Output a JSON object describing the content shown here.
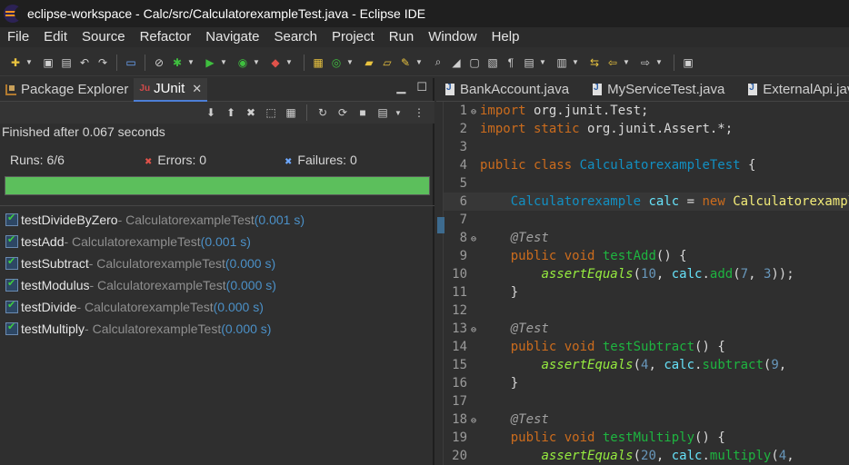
{
  "window": {
    "title": "eclipse-workspace - Calc/src/CalculatorexampleTest.java - Eclipse IDE"
  },
  "menu": [
    "File",
    "Edit",
    "Source",
    "Refactor",
    "Navigate",
    "Search",
    "Project",
    "Run",
    "Window",
    "Help"
  ],
  "colors": {
    "accent": "#4d7fd6",
    "progress_ok": "#5cbf5c",
    "time": "#4b90c7"
  },
  "left_tabs": {
    "package_explorer": "Package Explorer",
    "junit": "JUnit"
  },
  "junit": {
    "finished": "Finished after 0.067 seconds",
    "runs_label": "Runs:",
    "runs_value": "6/6",
    "errors_label": "Errors:",
    "errors_value": "0",
    "failures_label": "Failures:",
    "failures_value": "0",
    "progress_fraction": 1.0,
    "tests": [
      {
        "name": "testDivideByZero",
        "cls": " - CalculatorexampleTest ",
        "time": "(0.001 s)"
      },
      {
        "name": "testAdd",
        "cls": " - CalculatorexampleTest ",
        "time": "(0.001 s)"
      },
      {
        "name": "testSubtract",
        "cls": " - CalculatorexampleTest ",
        "time": "(0.000 s)"
      },
      {
        "name": "testModulus",
        "cls": " - CalculatorexampleTest ",
        "time": "(0.000 s)"
      },
      {
        "name": "testDivide",
        "cls": " - CalculatorexampleTest ",
        "time": "(0.000 s)"
      },
      {
        "name": "testMultiply",
        "cls": " - CalculatorexampleTest ",
        "time": "(0.000 s)"
      }
    ]
  },
  "editor_tabs": [
    "BankAccount.java",
    "MyServiceTest.java",
    "ExternalApi.java"
  ],
  "code": {
    "lines": [
      {
        "n": "1",
        "fold": "⊖",
        "parts": [
          [
            "kw",
            "import"
          ],
          [
            "txt",
            " org.junit.Test;"
          ]
        ]
      },
      {
        "n": "2",
        "fold": "",
        "parts": [
          [
            "kw",
            "import static"
          ],
          [
            "txt",
            " org.junit.Assert.*;"
          ]
        ]
      },
      {
        "n": "3",
        "fold": "",
        "parts": []
      },
      {
        "n": "4",
        "fold": "",
        "parts": [
          [
            "kw",
            "public class"
          ],
          [
            "txt",
            " "
          ],
          [
            "ty",
            "CalculatorexampleTest"
          ],
          [
            "txt",
            " {"
          ]
        ]
      },
      {
        "n": "5",
        "fold": "",
        "parts": []
      },
      {
        "n": "6",
        "fold": "",
        "current": true,
        "parts": [
          [
            "txt",
            "    "
          ],
          [
            "ty",
            "Calculatorexample"
          ],
          [
            "txt",
            " "
          ],
          [
            "fld",
            "calc"
          ],
          [
            "txt",
            " = "
          ],
          [
            "kw",
            "new"
          ],
          [
            "txt",
            " "
          ],
          [
            "vr",
            "Calculatorexample"
          ],
          [
            "txt",
            "();"
          ]
        ]
      },
      {
        "n": "7",
        "fold": "",
        "parts": []
      },
      {
        "n": "8",
        "fold": "⊖",
        "parts": [
          [
            "txt",
            "    "
          ],
          [
            "ann",
            "@Test"
          ]
        ]
      },
      {
        "n": "9",
        "fold": "",
        "parts": [
          [
            "txt",
            "    "
          ],
          [
            "kw",
            "public void"
          ],
          [
            "txt",
            " "
          ],
          [
            "mth",
            "testAdd"
          ],
          [
            "txt",
            "() {"
          ]
        ]
      },
      {
        "n": "10",
        "fold": "",
        "parts": [
          [
            "txt",
            "        "
          ],
          [
            "sm",
            "assertEquals"
          ],
          [
            "txt",
            "("
          ],
          [
            "num",
            "10"
          ],
          [
            "txt",
            ", "
          ],
          [
            "fld",
            "calc"
          ],
          [
            "txt",
            "."
          ],
          [
            "mth",
            "add"
          ],
          [
            "txt",
            "("
          ],
          [
            "num",
            "7"
          ],
          [
            "txt",
            ", "
          ],
          [
            "num",
            "3"
          ],
          [
            "txt",
            "));"
          ]
        ]
      },
      {
        "n": "11",
        "fold": "",
        "parts": [
          [
            "txt",
            "    }"
          ]
        ]
      },
      {
        "n": "12",
        "fold": "",
        "parts": []
      },
      {
        "n": "13",
        "fold": "⊖",
        "parts": [
          [
            "txt",
            "    "
          ],
          [
            "ann",
            "@Test"
          ]
        ]
      },
      {
        "n": "14",
        "fold": "",
        "parts": [
          [
            "txt",
            "    "
          ],
          [
            "kw",
            "public void"
          ],
          [
            "txt",
            " "
          ],
          [
            "mth",
            "testSubtract"
          ],
          [
            "txt",
            "() {"
          ]
        ]
      },
      {
        "n": "15",
        "fold": "",
        "parts": [
          [
            "txt",
            "        "
          ],
          [
            "sm",
            "assertEquals"
          ],
          [
            "txt",
            "("
          ],
          [
            "num",
            "4"
          ],
          [
            "txt",
            ", "
          ],
          [
            "fld",
            "calc"
          ],
          [
            "txt",
            "."
          ],
          [
            "mth",
            "subtract"
          ],
          [
            "txt",
            "("
          ],
          [
            "num",
            "9"
          ],
          [
            "txt",
            ", "
          ]
        ]
      },
      {
        "n": "16",
        "fold": "",
        "parts": [
          [
            "txt",
            "    }"
          ]
        ]
      },
      {
        "n": "17",
        "fold": "",
        "parts": []
      },
      {
        "n": "18",
        "fold": "⊖",
        "parts": [
          [
            "txt",
            "    "
          ],
          [
            "ann",
            "@Test"
          ]
        ]
      },
      {
        "n": "19",
        "fold": "",
        "parts": [
          [
            "txt",
            "    "
          ],
          [
            "kw",
            "public void"
          ],
          [
            "txt",
            " "
          ],
          [
            "mth",
            "testMultiply"
          ],
          [
            "txt",
            "() {"
          ]
        ]
      },
      {
        "n": "20",
        "fold": "",
        "parts": [
          [
            "txt",
            "        "
          ],
          [
            "sm",
            "assertEquals"
          ],
          [
            "txt",
            "("
          ],
          [
            "num",
            "20"
          ],
          [
            "txt",
            ", "
          ],
          [
            "fld",
            "calc"
          ],
          [
            "txt",
            "."
          ],
          [
            "mth",
            "multiply"
          ],
          [
            "txt",
            "("
          ],
          [
            "num",
            "4"
          ],
          [
            "txt",
            ","
          ]
        ]
      }
    ]
  }
}
